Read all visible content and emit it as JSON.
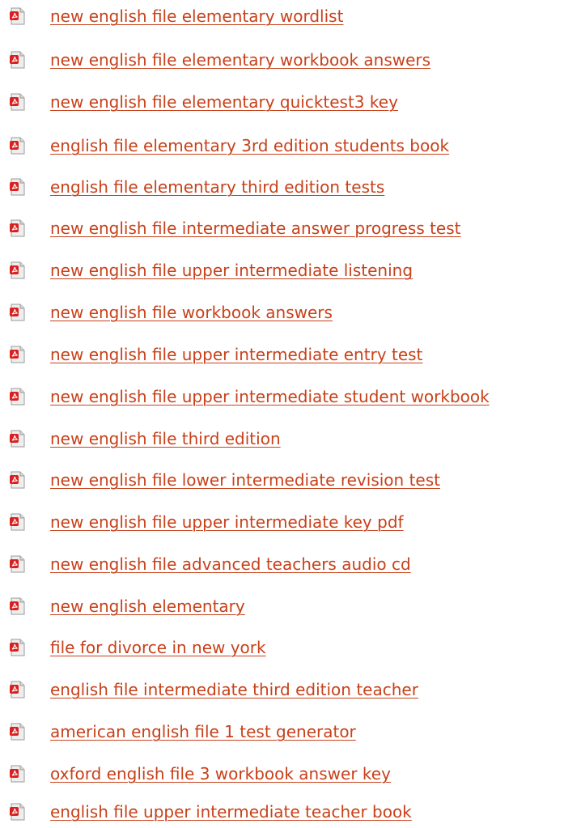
{
  "colors": {
    "link": "#c8411a",
    "icon_page": "#e6e6e6",
    "icon_badge": "#d92020"
  },
  "icon": "pdf-file-icon",
  "links": [
    "new english file elementary wordlist",
    "new english file elementary workbook answers",
    "new english file elementary quicktest3 key",
    "english file elementary 3rd edition students book",
    "english file elementary third edition tests",
    "new english file intermediate answer progress test",
    "new english file upper intermediate listening",
    "new english file workbook answers",
    "new english file upper intermediate entry test",
    "new english file upper intermediate student workbook",
    "new english file third edition",
    "new english file lower intermediate revision test",
    "new english file upper intermediate key pdf",
    "new english file advanced teachers audio cd",
    "new english elementary",
    "file for divorce in new york",
    "english file intermediate third edition teacher",
    "american english file 1 test generator",
    "oxford english file 3 workbook answer key",
    "english file upper intermediate teacher book"
  ]
}
